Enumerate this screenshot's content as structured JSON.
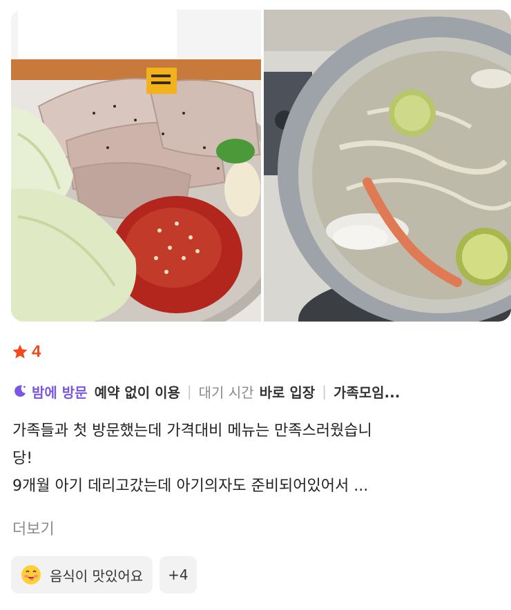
{
  "review": {
    "photos": [
      {
        "name": "bossam-platter-photo"
      },
      {
        "name": "hot-pot-photo"
      }
    ],
    "rating": {
      "value": "4",
      "star_color": "#f04a1d"
    },
    "tags": {
      "visit_time": "밤에 방문",
      "reservation_label": "예약 없이 이용",
      "wait_label": "대기 시간",
      "wait_value": "바로 입장",
      "purpose": "가족모임..."
    },
    "text_lines": [
      "가족들과 첫 방문했는데 가격대비 메뉴는 만족스러웠습니",
      "당!",
      "9개월 아기 데리고갔는데 아기의자도 준비되어있어서 ..."
    ],
    "more_label": "더보기",
    "keywords": {
      "first_label": "음식이 맛있어요",
      "more_count": "+4"
    },
    "colors": {
      "accent_purple": "#7a55e6",
      "muted": "#8a8a8a",
      "chip_bg": "#f2f2f2"
    }
  }
}
